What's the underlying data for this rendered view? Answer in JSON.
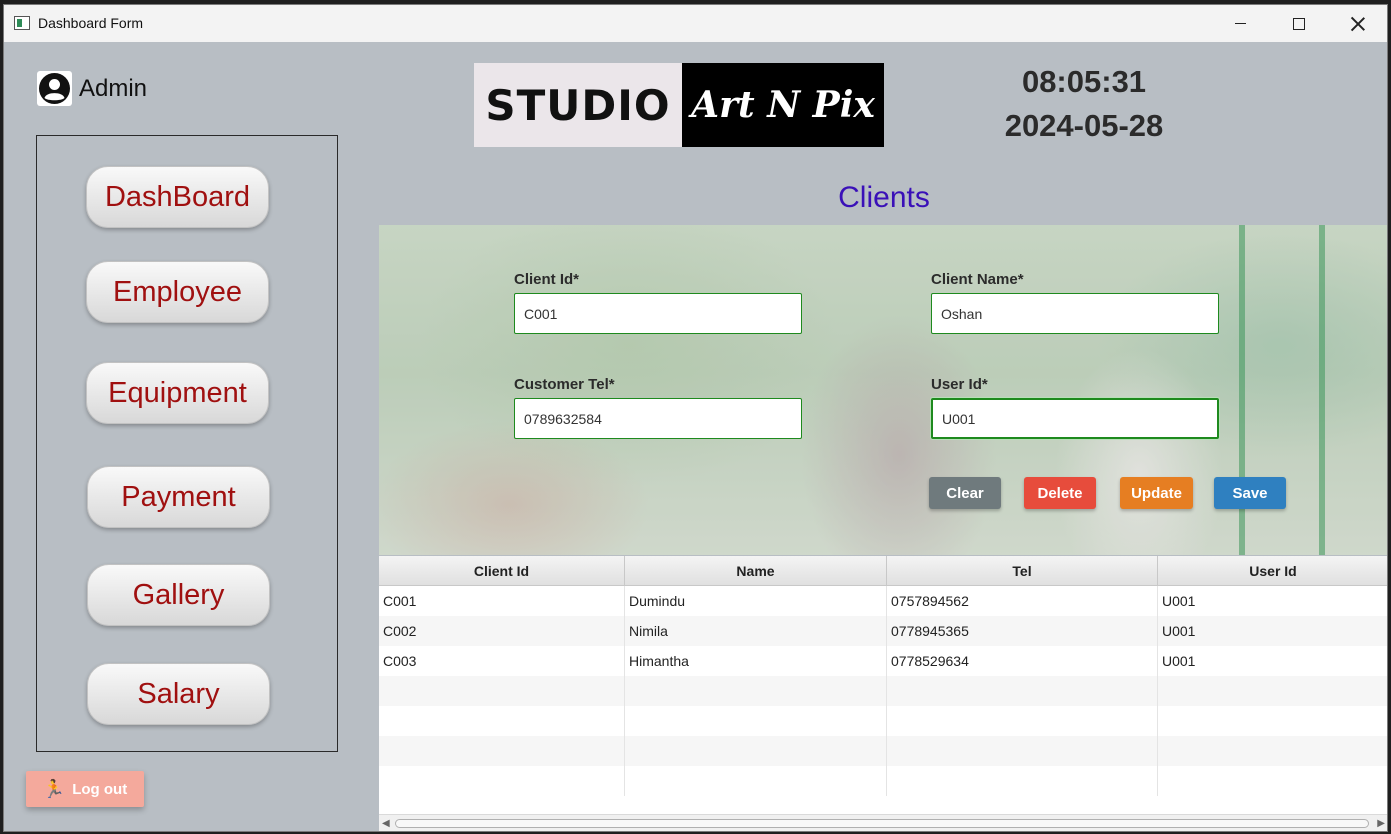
{
  "window": {
    "title": "Dashboard Form"
  },
  "user": {
    "name": "Admin"
  },
  "nav": {
    "items": [
      "DashBoard",
      "Employee",
      "Equipment",
      "Payment",
      "Gallery",
      "Salary"
    ],
    "logout_label": "Log out"
  },
  "logo": {
    "left_text": "STUDIO",
    "right_text": "Art N Pix"
  },
  "clock": {
    "time": "08:05:31",
    "date": "2024-05-28"
  },
  "section": {
    "title": "Clients"
  },
  "form": {
    "client_id": {
      "label": "Client Id*",
      "value": "C001"
    },
    "client_name": {
      "label": "Client Name*",
      "value": "Oshan"
    },
    "customer_tel": {
      "label": "Customer Tel*",
      "value": "0789632584"
    },
    "user_id": {
      "label": "User Id*",
      "value": "U001"
    }
  },
  "actions": {
    "clear": "Clear",
    "delete": "Delete",
    "update": "Update",
    "save": "Save",
    "colors": {
      "clear": "#6f7a7d",
      "delete": "#e74c3c",
      "update": "#e67e22",
      "save": "#2f80c0"
    }
  },
  "table": {
    "headers": [
      "Client Id",
      "Name",
      "Tel",
      "User Id"
    ],
    "rows": [
      [
        "C001",
        "Dumindu",
        "0757894562",
        "U001"
      ],
      [
        "C002",
        "Nimila",
        "0778945365",
        "U001"
      ],
      [
        "C003",
        "Himantha",
        "0778529634",
        "U001"
      ]
    ]
  },
  "colors": {
    "accent_title": "#3a10b8",
    "nav_text": "#a01010",
    "logout_bg": "#f4a99c",
    "input_border": "#1e8a1e"
  }
}
